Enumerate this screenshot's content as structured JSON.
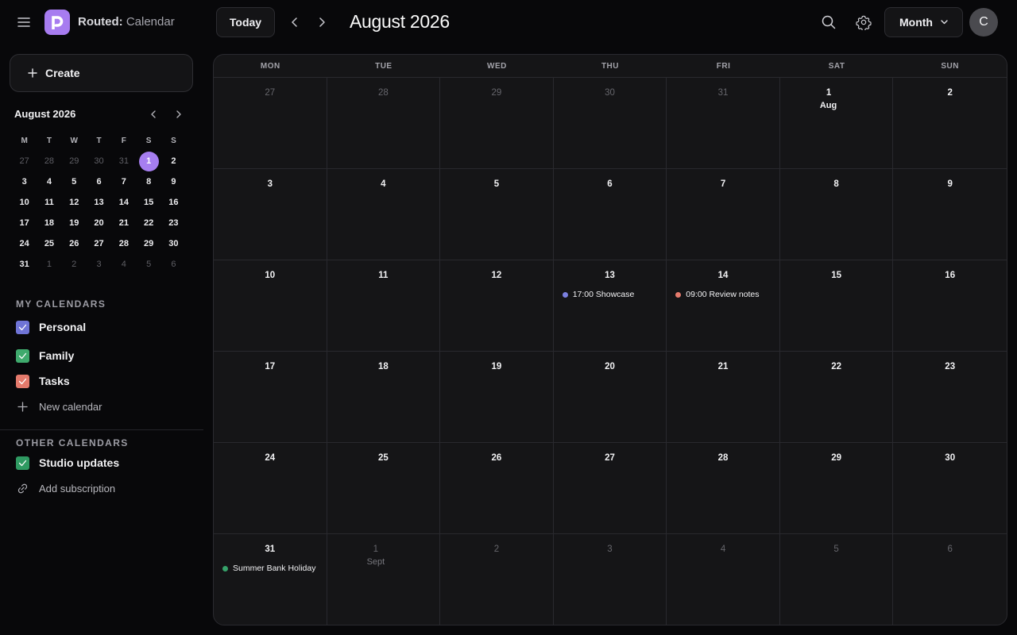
{
  "header": {
    "app_name_bold": "Routed:",
    "app_name_rest": " Calendar",
    "today_label": "Today",
    "period_title": "August 2026",
    "view_label": "Month",
    "avatar_initial": "C"
  },
  "sidebar": {
    "create_label": "Create",
    "mini_calendar": {
      "title": "August 2026",
      "weekdays": [
        "M",
        "T",
        "W",
        "T",
        "F",
        "S",
        "S"
      ],
      "days": [
        {
          "n": "27",
          "muted": true
        },
        {
          "n": "28",
          "muted": true
        },
        {
          "n": "29",
          "muted": true
        },
        {
          "n": "30",
          "muted": true
        },
        {
          "n": "31",
          "muted": true
        },
        {
          "n": "1",
          "selected": true
        },
        {
          "n": "2"
        },
        {
          "n": "3"
        },
        {
          "n": "4"
        },
        {
          "n": "5"
        },
        {
          "n": "6"
        },
        {
          "n": "7"
        },
        {
          "n": "8"
        },
        {
          "n": "9"
        },
        {
          "n": "10"
        },
        {
          "n": "11"
        },
        {
          "n": "12"
        },
        {
          "n": "13"
        },
        {
          "n": "14"
        },
        {
          "n": "15"
        },
        {
          "n": "16"
        },
        {
          "n": "17"
        },
        {
          "n": "18"
        },
        {
          "n": "19"
        },
        {
          "n": "20"
        },
        {
          "n": "21"
        },
        {
          "n": "22"
        },
        {
          "n": "23"
        },
        {
          "n": "24"
        },
        {
          "n": "25"
        },
        {
          "n": "26"
        },
        {
          "n": "27"
        },
        {
          "n": "28"
        },
        {
          "n": "29"
        },
        {
          "n": "30"
        },
        {
          "n": "31"
        },
        {
          "n": "1",
          "muted": true
        },
        {
          "n": "2",
          "muted": true
        },
        {
          "n": "3",
          "muted": true
        },
        {
          "n": "4",
          "muted": true
        },
        {
          "n": "5",
          "muted": true
        },
        {
          "n": "6",
          "muted": true
        }
      ]
    },
    "my_calendars_label": "MY CALENDARS",
    "my_calendars": [
      {
        "name": "Personal",
        "color": "#6f74d6"
      },
      {
        "name": "Family",
        "color": "#3faa6d"
      },
      {
        "name": "Tasks",
        "color": "#e47a6c"
      }
    ],
    "new_calendar_label": "New calendar",
    "other_calendars_label": "OTHER CALENDARS",
    "other_calendars": [
      {
        "name": "Studio updates",
        "color": "#2f9a62"
      }
    ],
    "add_subscription_label": "Add subscription"
  },
  "month_view": {
    "weekdays": [
      "MON",
      "TUE",
      "WED",
      "THU",
      "FRI",
      "SAT",
      "SUN"
    ],
    "days": [
      {
        "n": "27",
        "muted": true
      },
      {
        "n": "28",
        "muted": true
      },
      {
        "n": "29",
        "muted": true
      },
      {
        "n": "30",
        "muted": true
      },
      {
        "n": "31",
        "muted": true
      },
      {
        "n": "1",
        "month": "Aug"
      },
      {
        "n": "2"
      },
      {
        "n": "3"
      },
      {
        "n": "4"
      },
      {
        "n": "5"
      },
      {
        "n": "6"
      },
      {
        "n": "7"
      },
      {
        "n": "8"
      },
      {
        "n": "9"
      },
      {
        "n": "10"
      },
      {
        "n": "11"
      },
      {
        "n": "12"
      },
      {
        "n": "13",
        "events": [
          {
            "label": "17:00 Showcase",
            "color": "#7b80e0"
          }
        ]
      },
      {
        "n": "14",
        "events": [
          {
            "label": "09:00 Review notes",
            "color": "#e47a6c"
          }
        ]
      },
      {
        "n": "15"
      },
      {
        "n": "16"
      },
      {
        "n": "17"
      },
      {
        "n": "18"
      },
      {
        "n": "19"
      },
      {
        "n": "20"
      },
      {
        "n": "21"
      },
      {
        "n": "22"
      },
      {
        "n": "23"
      },
      {
        "n": "24"
      },
      {
        "n": "25"
      },
      {
        "n": "26"
      },
      {
        "n": "27"
      },
      {
        "n": "28"
      },
      {
        "n": "29"
      },
      {
        "n": "30"
      },
      {
        "n": "31",
        "events": [
          {
            "label": "Summer Bank Holiday",
            "color": "#36a26a"
          }
        ]
      },
      {
        "n": "1",
        "month": "Sept",
        "muted": true
      },
      {
        "n": "2",
        "muted": true
      },
      {
        "n": "3",
        "muted": true
      },
      {
        "n": "4",
        "muted": true
      },
      {
        "n": "5",
        "muted": true
      },
      {
        "n": "6",
        "muted": true
      }
    ]
  }
}
